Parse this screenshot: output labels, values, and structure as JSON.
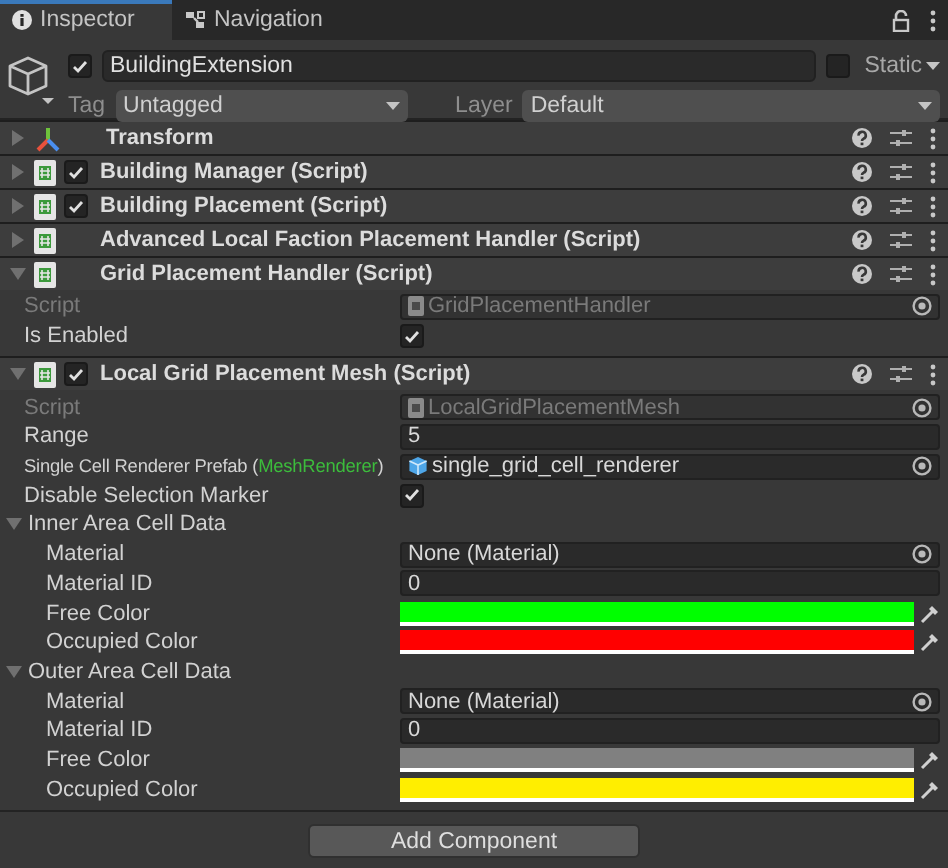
{
  "tabs": [
    {
      "label": "Inspector",
      "selected": true
    },
    {
      "label": "Navigation",
      "selected": false
    }
  ],
  "object": {
    "active": true,
    "name": "BuildingExtension",
    "static": false,
    "static_label": "Static",
    "tag_label": "Tag",
    "tag": "Untagged",
    "layer_label": "Layer",
    "layer": "Default"
  },
  "components": [
    {
      "kind": "transform",
      "title": "Transform",
      "expanded": false
    },
    {
      "kind": "script",
      "title": "Building Manager (Script)",
      "enabled": true,
      "expanded": false
    },
    {
      "kind": "script",
      "title": "Building Placement (Script)",
      "enabled": true,
      "expanded": false
    },
    {
      "kind": "script",
      "title": "Advanced Local Faction Placement Handler (Script)",
      "expanded": false
    },
    {
      "kind": "script",
      "title": "Grid Placement Handler (Script)",
      "expanded": true,
      "properties": [
        {
          "kind": "script",
          "label": "Script",
          "value": "GridPlacementHandler"
        },
        {
          "kind": "toggle",
          "label": "Is Enabled",
          "checked": true
        }
      ]
    },
    {
      "kind": "script",
      "title": "Local Grid Placement Mesh (Script)",
      "enabled": true,
      "expanded": true,
      "properties": [
        {
          "kind": "script",
          "label": "Script",
          "value": "LocalGridPlacementMesh"
        },
        {
          "kind": "number",
          "label": "Range",
          "value": "5"
        },
        {
          "kind": "prefab",
          "label": "Single Cell Renderer Prefab (",
          "type_name": "MeshRenderer",
          "label_end": ")",
          "value": "single_grid_cell_renderer"
        },
        {
          "kind": "toggle",
          "label": "Disable Selection Marker",
          "checked": true
        },
        {
          "kind": "group",
          "label": "Inner Area Cell Data",
          "expanded": true,
          "children": [
            {
              "kind": "object",
              "label": "Material",
              "value": "None (Material)"
            },
            {
              "kind": "number",
              "label": "Material ID",
              "value": "0"
            },
            {
              "kind": "color",
              "label": "Free Color",
              "color": "#00ff00"
            },
            {
              "kind": "color",
              "label": "Occupied Color",
              "color": "#ff0000"
            }
          ]
        },
        {
          "kind": "group",
          "label": "Outer Area Cell Data",
          "expanded": true,
          "children": [
            {
              "kind": "object",
              "label": "Material",
              "value": "None (Material)"
            },
            {
              "kind": "number",
              "label": "Material ID",
              "value": "0"
            },
            {
              "kind": "color",
              "label": "Free Color",
              "color": "#808080"
            },
            {
              "kind": "color",
              "label": "Occupied Color",
              "color": "#ffee00"
            }
          ]
        }
      ]
    }
  ],
  "add_component": "Add Component"
}
